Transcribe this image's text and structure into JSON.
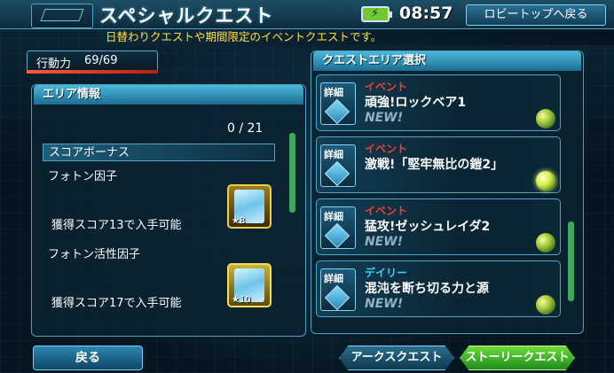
{
  "header": {
    "title": "スペシャルクエスト",
    "logo_text": "",
    "time": "08:57",
    "lobby_button": "ロビートップへ戻る",
    "battery_icon": "battery-charging-icon"
  },
  "subtitle": "日替わりクエストや期間限定のイベントクエストです。",
  "stamina": {
    "label": "行動力",
    "value": "69/69",
    "fill": 1.0
  },
  "area_info": {
    "title": "エリア情報",
    "count": "0 / 21",
    "score_bonus_label": "スコアボーナス",
    "items": [
      {
        "name": "フォトン因子",
        "text": "獲得スコア13で入手可能",
        "stars": "★8"
      },
      {
        "name": "フォトン活性因子",
        "text": "獲得スコア17で入手可能",
        "stars": "★10"
      }
    ]
  },
  "quest_area": {
    "title": "クエストエリア選択",
    "detail_label": "詳細",
    "quests": [
      {
        "type": "イベント",
        "title": "頑強!ロックベア1",
        "badge": "NEW!"
      },
      {
        "type": "イベント",
        "title": "激戦!「堅牢無比の鎧2」",
        "badge": ""
      },
      {
        "type": "イベント",
        "title": "猛攻!ゼッシュレイダ2",
        "badge": "NEW!"
      },
      {
        "type": "デイリー",
        "title": "混沌を断ち切る力と源",
        "badge": "NEW!"
      }
    ]
  },
  "footer": {
    "back": "戻る",
    "arks": "アークスクエスト",
    "story": "ストーリークエスト"
  },
  "colors": {
    "event": "#ff3b2f",
    "daily": "#3fd0ff",
    "accent": "#4aa7c8",
    "story": "#37b52a"
  }
}
